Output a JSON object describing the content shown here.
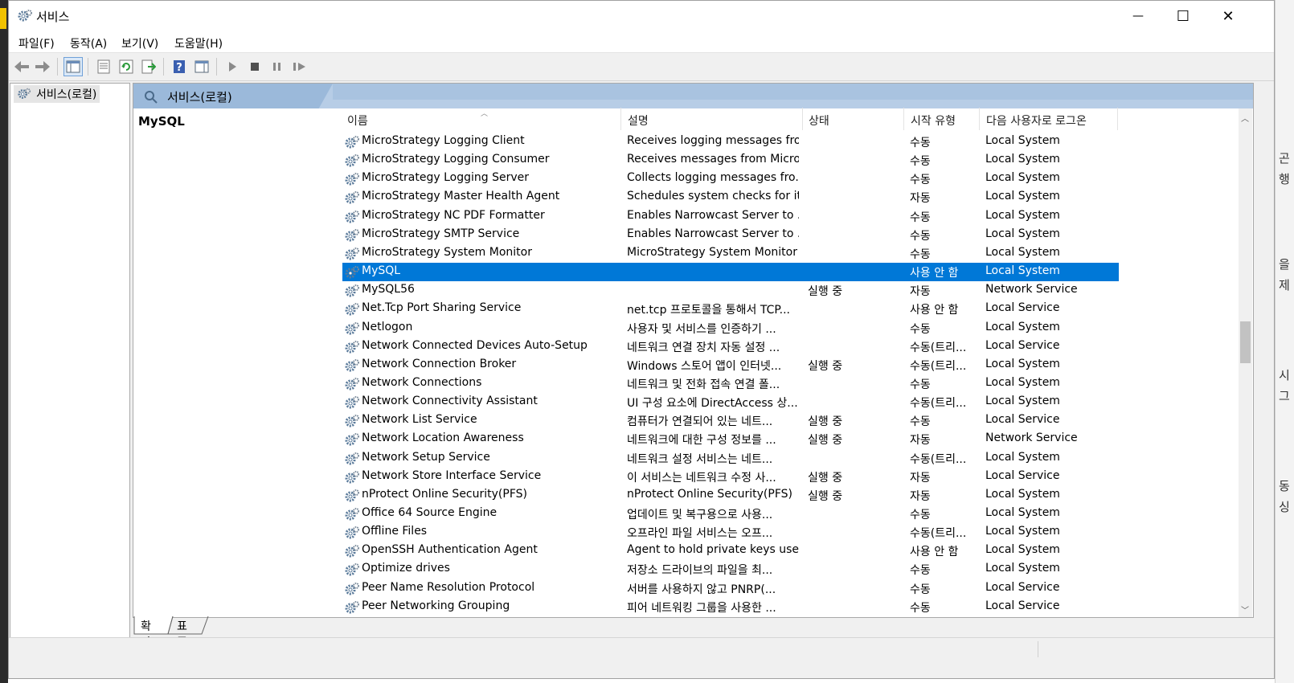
{
  "window": {
    "title": "서비스",
    "minimize": "—",
    "maximize": "☐",
    "close": "✕"
  },
  "menu": [
    "파일(F)",
    "동작(A)",
    "보기(V)",
    "도움말(H)"
  ],
  "tree": {
    "root_label": "서비스(로컬)"
  },
  "panel": {
    "header": "서비스(로컬)",
    "selected_title": "MySQL"
  },
  "columns": {
    "name": "이름",
    "description": "설명",
    "status": "상태",
    "startup": "시작 유형",
    "logon": "다음 사용자로 로그온"
  },
  "rows": [
    {
      "name": "MicroStrategy Logging Client",
      "description": "Receives logging messages fro...",
      "status": "",
      "startup": "수동",
      "logon": "Local System"
    },
    {
      "name": "MicroStrategy Logging Consumer",
      "description": "Receives messages from Micro...",
      "status": "",
      "startup": "수동",
      "logon": "Local System"
    },
    {
      "name": "MicroStrategy Logging Server",
      "description": "Collects logging messages fro...",
      "status": "",
      "startup": "수동",
      "logon": "Local System"
    },
    {
      "name": "MicroStrategy Master Health Agent",
      "description": "Schedules system checks for it...",
      "status": "",
      "startup": "자동",
      "logon": "Local System"
    },
    {
      "name": "MicroStrategy NC PDF Formatter",
      "description": "Enables Narrowcast Server to ...",
      "status": "",
      "startup": "수동",
      "logon": "Local System"
    },
    {
      "name": "MicroStrategy SMTP Service",
      "description": "Enables Narrowcast Server to ...",
      "status": "",
      "startup": "수동",
      "logon": "Local System"
    },
    {
      "name": "MicroStrategy System Monitor",
      "description": "MicroStrategy System Monitor",
      "status": "",
      "startup": "수동",
      "logon": "Local System"
    },
    {
      "name": "MySQL",
      "description": "",
      "status": "",
      "startup": "사용 안 함",
      "logon": "Local System",
      "selected": true
    },
    {
      "name": "MySQL56",
      "description": "",
      "status": "실행 중",
      "startup": "자동",
      "logon": "Network Service"
    },
    {
      "name": "Net.Tcp Port Sharing Service",
      "description": "net.tcp 프로토콜을 통해서 TCP...",
      "status": "",
      "startup": "사용 안 함",
      "logon": "Local Service"
    },
    {
      "name": "Netlogon",
      "description": "사용자 및 서비스를 인증하기 ...",
      "status": "",
      "startup": "수동",
      "logon": "Local System"
    },
    {
      "name": "Network Connected Devices Auto-Setup",
      "description": "네트워크 연결 장치 자동 설정 ...",
      "status": "",
      "startup": "수동(트리...",
      "logon": "Local Service"
    },
    {
      "name": "Network Connection Broker",
      "description": "Windows 스토어 앱이 인터넷...",
      "status": "실행 중",
      "startup": "수동(트리...",
      "logon": "Local System"
    },
    {
      "name": "Network Connections",
      "description": "네트워크 및 전화 접속 연결 폴...",
      "status": "",
      "startup": "수동",
      "logon": "Local System"
    },
    {
      "name": "Network Connectivity Assistant",
      "description": "UI 구성 요소에 DirectAccess 상...",
      "status": "",
      "startup": "수동(트리...",
      "logon": "Local System"
    },
    {
      "name": "Network List Service",
      "description": "컴퓨터가 연결되어 있는 네트...",
      "status": "실행 중",
      "startup": "수동",
      "logon": "Local Service"
    },
    {
      "name": "Network Location Awareness",
      "description": "네트워크에 대한 구성 정보를 ...",
      "status": "실행 중",
      "startup": "자동",
      "logon": "Network Service"
    },
    {
      "name": "Network Setup Service",
      "description": "네트워크 설정 서비스는 네트...",
      "status": "",
      "startup": "수동(트리...",
      "logon": "Local System"
    },
    {
      "name": "Network Store Interface Service",
      "description": "이 서비스는 네트워크 수정 사...",
      "status": "실행 중",
      "startup": "자동",
      "logon": "Local Service"
    },
    {
      "name": "nProtect Online Security(PFS)",
      "description": "nProtect Online Security(PFS)",
      "status": "실행 중",
      "startup": "자동",
      "logon": "Local System"
    },
    {
      "name": "Office 64 Source Engine",
      "description": "업데이트 및 복구용으로 사용...",
      "status": "",
      "startup": "수동",
      "logon": "Local System"
    },
    {
      "name": "Offline Files",
      "description": "오프라인 파일 서비스는 오프...",
      "status": "",
      "startup": "수동(트리...",
      "logon": "Local System"
    },
    {
      "name": "OpenSSH Authentication Agent",
      "description": "Agent to hold private keys use...",
      "status": "",
      "startup": "사용 안 함",
      "logon": "Local System"
    },
    {
      "name": "Optimize drives",
      "description": "저장소 드라이브의 파일을 최...",
      "status": "",
      "startup": "수동",
      "logon": "Local System"
    },
    {
      "name": "Peer Name Resolution Protocol",
      "description": "서버를 사용하지 않고 PNRP(...",
      "status": "",
      "startup": "수동",
      "logon": "Local Service"
    },
    {
      "name": "Peer Networking Grouping",
      "description": "피어 네트워킹 그룹을 사용한 ...",
      "status": "",
      "startup": "수동",
      "logon": "Local Service"
    }
  ],
  "bottom_tabs": {
    "extended": "확장",
    "standard": "표준"
  },
  "desktop_right_glyphs": [
    "곤",
    "행",
    "을",
    "제",
    "시",
    "그",
    "동",
    "싱"
  ],
  "colors": {
    "selection": "#0078d7",
    "header_band": "#b7cde6"
  }
}
